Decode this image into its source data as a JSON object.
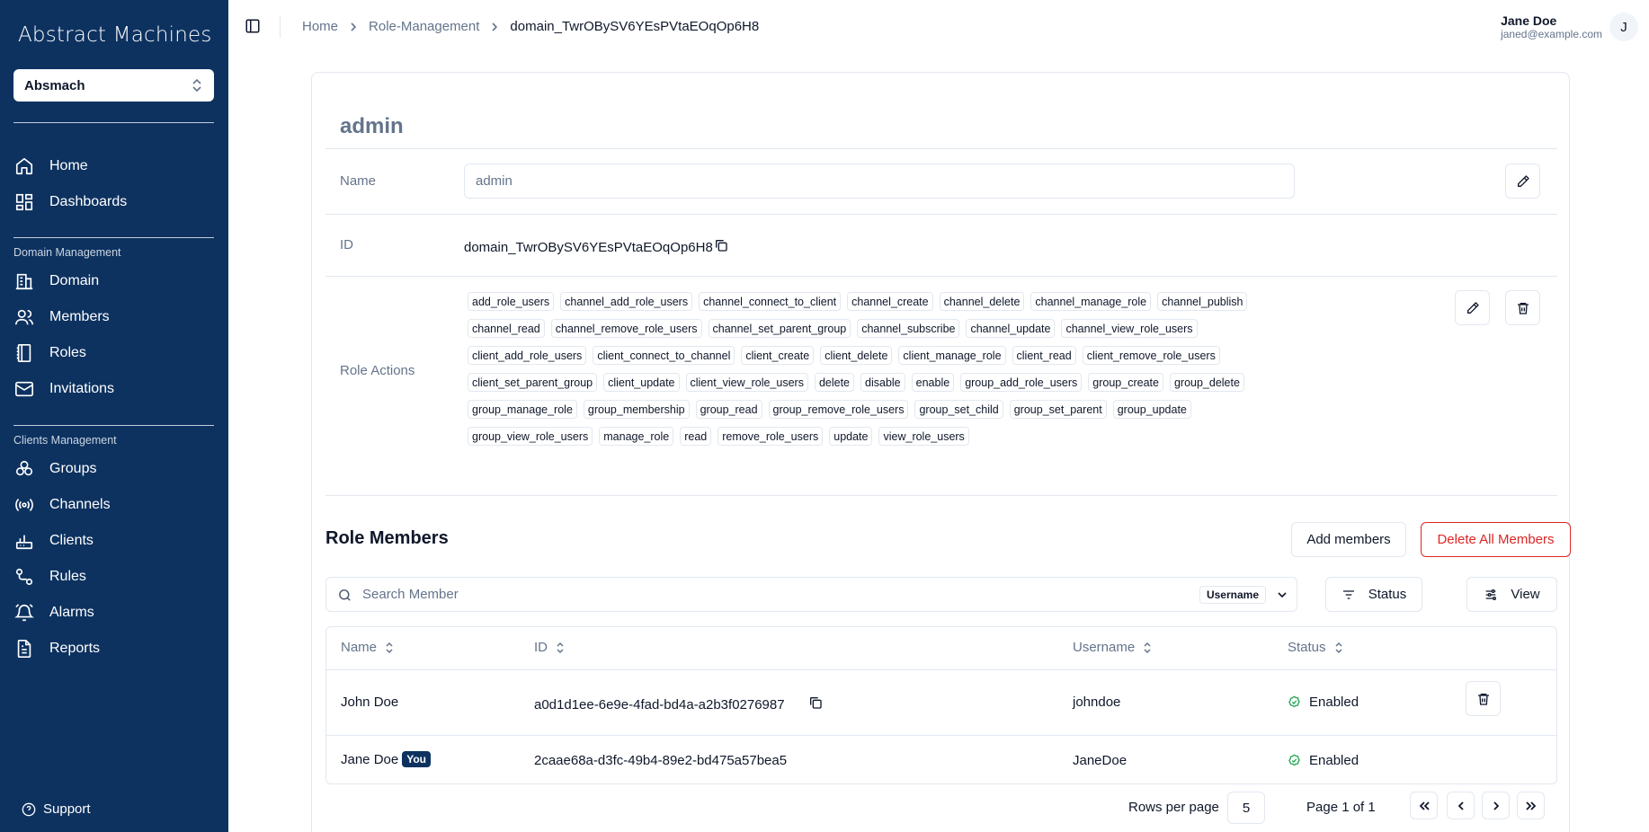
{
  "app": {
    "brand": "Abstract Machines",
    "org_selected": "Absmach",
    "support_label": "Support"
  },
  "sidebar": {
    "top_items": [
      {
        "label": "Home",
        "icon": "home-icon"
      },
      {
        "label": "Dashboards",
        "icon": "dashboard-icon"
      }
    ],
    "domain_section": "Domain Management",
    "domain_items": [
      {
        "label": "Domain",
        "icon": "domain-icon"
      },
      {
        "label": "Members",
        "icon": "members-icon"
      },
      {
        "label": "Roles",
        "icon": "roles-icon"
      },
      {
        "label": "Invitations",
        "icon": "mail-icon"
      }
    ],
    "clients_section": "Clients Management",
    "clients_items": [
      {
        "label": "Groups",
        "icon": "groups-icon"
      },
      {
        "label": "Channels",
        "icon": "channels-icon"
      },
      {
        "label": "Clients",
        "icon": "clients-icon"
      },
      {
        "label": "Rules",
        "icon": "rules-icon"
      },
      {
        "label": "Alarms",
        "icon": "bell-icon"
      },
      {
        "label": "Reports",
        "icon": "report-icon"
      }
    ]
  },
  "header": {
    "breadcrumb": [
      "Home",
      "Role-Management",
      "domain_TwrOBySV6YEsPVtaEOqOp6H8"
    ],
    "user_name": "Jane Doe",
    "user_email": "janed@example.com",
    "avatar_initial": "J"
  },
  "role": {
    "title": "admin",
    "name_label": "Name",
    "name_value": "admin",
    "id_label": "ID",
    "id_value": "domain_TwrOBySV6YEsPVtaEOqOp6H8",
    "actions_label": "Role Actions",
    "actions": [
      "add_role_users",
      "channel_add_role_users",
      "channel_connect_to_client",
      "channel_create",
      "channel_delete",
      "channel_manage_role",
      "channel_publish",
      "channel_read",
      "channel_remove_role_users",
      "channel_set_parent_group",
      "channel_subscribe",
      "channel_update",
      "channel_view_role_users",
      "client_add_role_users",
      "client_connect_to_channel",
      "client_create",
      "client_delete",
      "client_manage_role",
      "client_read",
      "client_remove_role_users",
      "client_set_parent_group",
      "client_update",
      "client_view_role_users",
      "delete",
      "disable",
      "enable",
      "group_add_role_users",
      "group_create",
      "group_delete",
      "group_manage_role",
      "group_membership",
      "group_read",
      "group_remove_role_users",
      "group_set_child",
      "group_set_parent",
      "group_update",
      "group_view_role_users",
      "manage_role",
      "read",
      "remove_role_users",
      "update",
      "view_role_users"
    ]
  },
  "members": {
    "title": "Role Members",
    "add_label": "Add members",
    "delete_all_label": "Delete All Members",
    "search_placeholder": "Search Member",
    "search_type": "Username",
    "status_filter": "Status",
    "view_label": "View",
    "columns": [
      "Name",
      "ID",
      "Username",
      "Status"
    ],
    "rows": [
      {
        "name": "John Doe",
        "you": "",
        "id": "a0d1d1ee-6e9e-4fad-bd4a-a2b3f0276987",
        "username": "johndoe",
        "status": "Enabled"
      },
      {
        "name": "Jane Doe",
        "you": "You",
        "id": "2caae68a-d3fc-49b4-89e2-bd475a57bea5",
        "username": "JaneDoe",
        "status": "Enabled"
      }
    ],
    "rows_per_page_label": "Rows per page",
    "rows_per_page": "5",
    "page_info": "Page 1 of 1"
  }
}
